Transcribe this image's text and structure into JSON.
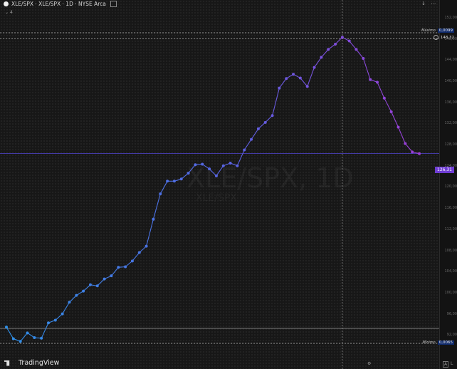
{
  "header": {
    "title": "XLE/SPX · XLE/SPX · 1D · NYSE Arca",
    "indicator_count": "4"
  },
  "watermark": {
    "main": "XLE/SPX, 1D",
    "sub": "XLE/SPX"
  },
  "right_axis": {
    "max_label": "Máximo",
    "max_value": "0,0099",
    "max_price": "148,32",
    "min_label": "Mínimo",
    "min_value": "0,0065",
    "current_price": "126,31",
    "ticks": [
      "152,00",
      "148,00",
      "144,00",
      "140,00",
      "136,00",
      "132,00",
      "128,00",
      "124,00",
      "120,00",
      "116,00",
      "112,00",
      "108,00",
      "104,00",
      "100,00",
      "96,00",
      "92,00"
    ]
  },
  "footer": {
    "brand": "TradingView",
    "btn_a": "A",
    "btn_l": "L"
  },
  "colors": {
    "line_start": "#2f8fe6",
    "line_mid": "#5a62e2",
    "line_end": "#9c3ed6",
    "badge": "#0f2a6b",
    "price_tag": "#6e3cd3"
  },
  "chart_data": {
    "type": "line",
    "title": "XLE/SPX · XLE/SPX · 1D · NYSE Arca",
    "values": [
      93.5,
      91.3,
      90.8,
      92.4,
      91.5,
      91.4,
      94.3,
      94.8,
      96.0,
      98.2,
      99.5,
      100.3,
      101.5,
      101.3,
      102.6,
      103.2,
      104.8,
      104.9,
      106.0,
      107.6,
      108.8,
      113.9,
      118.7,
      121.1,
      121.1,
      121.5,
      122.6,
      124.2,
      124.3,
      123.4,
      122.1,
      124.0,
      124.5,
      124.0,
      127.0,
      129.0,
      131.0,
      132.2,
      133.5,
      138.7,
      140.5,
      141.3,
      140.6,
      139.0,
      142.6,
      144.5,
      146.0,
      147.0,
      148.3,
      147.6,
      146.0,
      144.3,
      140.3,
      139.8,
      136.8,
      134.2,
      131.3,
      128.2,
      126.6,
      126.3
    ],
    "ylim": [
      88,
      154
    ],
    "grid": false,
    "max_price": 148.32,
    "current_price": 126.31
  }
}
